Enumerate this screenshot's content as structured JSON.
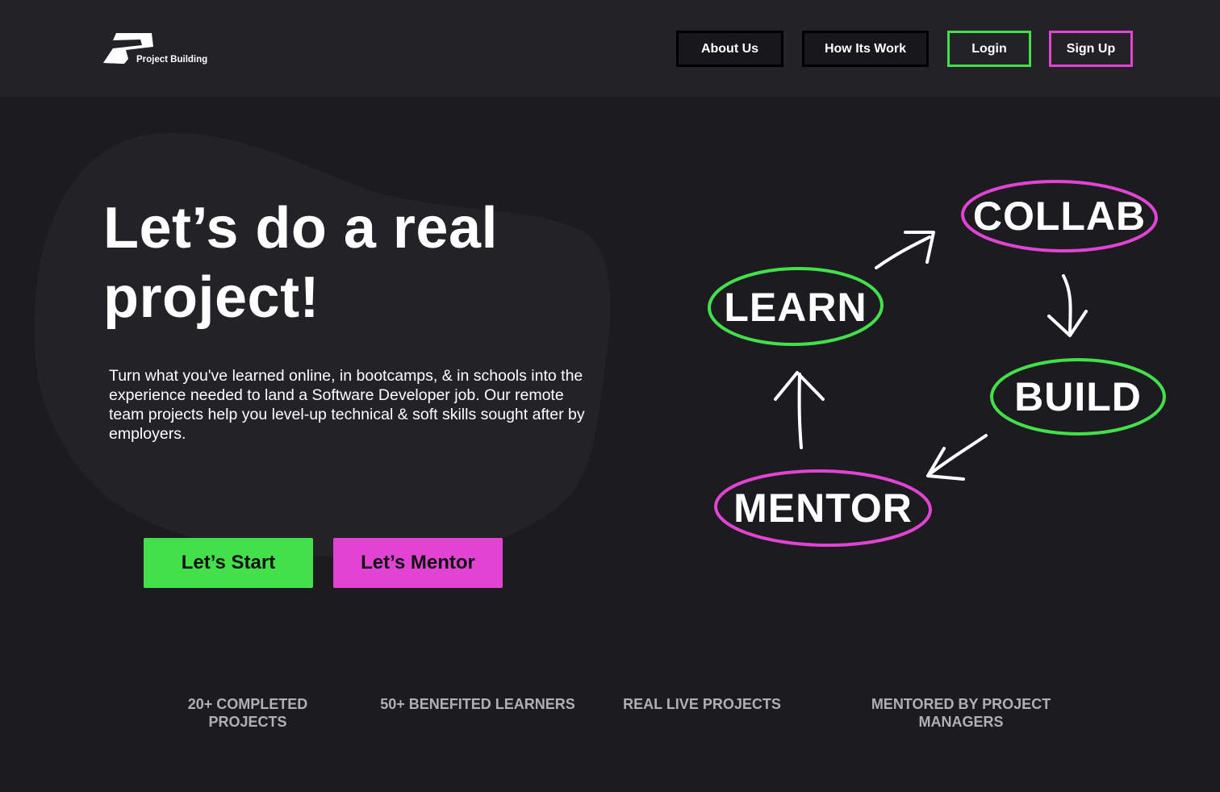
{
  "header": {
    "logo_text": "Project Building",
    "nav": {
      "about": "About Us",
      "how": "How Its Work",
      "login": "Login",
      "signup": "Sign Up"
    }
  },
  "hero": {
    "title_line1": "Let’s do a real",
    "title_line2": "project!",
    "description": "Turn what you've learned online, in bootcamps, & in schools into the experience needed to land a Software Developer job. Our remote team projects help you level-up technical & soft skills sought after by employers.",
    "cta_start": "Let’s Start",
    "cta_mentor": "Let’s Mentor"
  },
  "diagram": {
    "learn": "LEARN",
    "collab": "COLLAB",
    "build": "BUILD",
    "mentor": "MENTOR"
  },
  "stats": [
    "20+ COMPLETED PROJECTS",
    "50+ BENEFITED LEARNERS",
    "REAL LIVE PROJECTS",
    "MENTORED BY PROJECT MANAGERS"
  ],
  "colors": {
    "accent_green": "#44e04c",
    "accent_pink": "#e144d3",
    "background": "#1c1c20",
    "header_bg": "#222227",
    "blob": "#222227"
  }
}
